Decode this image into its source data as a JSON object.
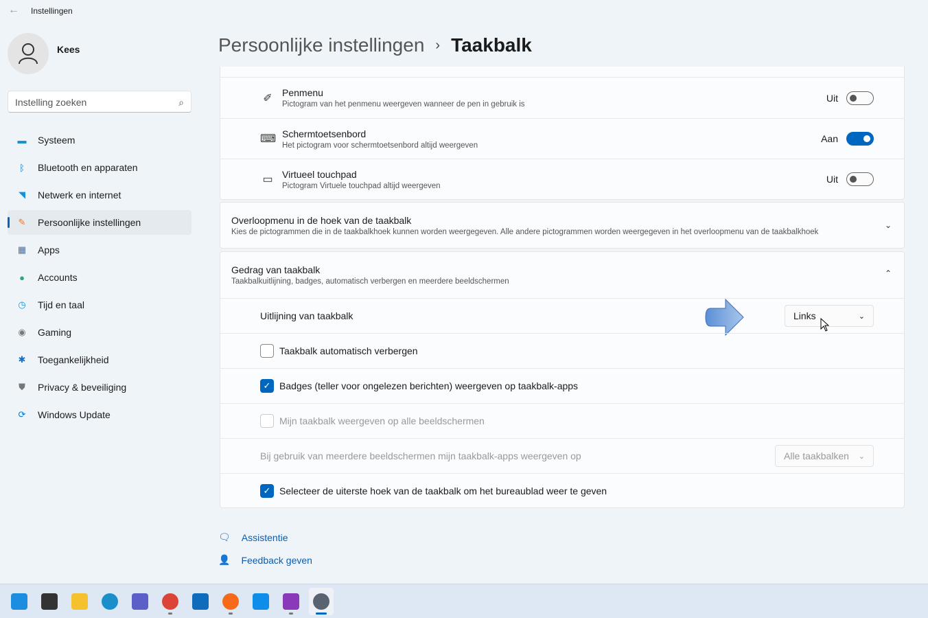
{
  "app": {
    "title": "Instellingen",
    "user": "Kees"
  },
  "search": {
    "placeholder": "Instelling zoeken"
  },
  "nav": [
    {
      "label": "Systeem",
      "icon": "monitor-icon",
      "color": "#1a8fd1"
    },
    {
      "label": "Bluetooth en apparaten",
      "icon": "bluetooth-icon",
      "color": "#0078d4"
    },
    {
      "label": "Netwerk en internet",
      "icon": "wifi-icon",
      "color": "#1a8fd1"
    },
    {
      "label": "Persoonlijke instellingen",
      "icon": "brush-icon",
      "color": "#e07b39",
      "selected": true
    },
    {
      "label": "Apps",
      "icon": "apps-icon",
      "color": "#4a6fa5"
    },
    {
      "label": "Accounts",
      "icon": "person-icon",
      "color": "#2ea67a"
    },
    {
      "label": "Tijd en taal",
      "icon": "clock-globe-icon",
      "color": "#1a8fd1"
    },
    {
      "label": "Gaming",
      "icon": "gamepad-icon",
      "color": "#777"
    },
    {
      "label": "Toegankelijkheid",
      "icon": "accessibility-icon",
      "color": "#1a6fc9"
    },
    {
      "label": "Privacy & beveiliging",
      "icon": "shield-icon",
      "color": "#777"
    },
    {
      "label": "Windows Update",
      "icon": "update-icon",
      "color": "#0078d4"
    }
  ],
  "breadcrumb": {
    "parent": "Persoonlijke instellingen",
    "sep": "›",
    "current": "Taakbalk"
  },
  "pen_rows": [
    {
      "title": "Penmenu",
      "desc": "Pictogram van het penmenu weergeven wanneer de pen in gebruik is",
      "state": "Uit",
      "on": false,
      "icon": "pen-icon"
    },
    {
      "title": "Schermtoetsenbord",
      "desc": "Het pictogram voor schermtoetsenbord altijd weergeven",
      "state": "Aan",
      "on": true,
      "icon": "keyboard-icon"
    },
    {
      "title": "Virtueel touchpad",
      "desc": "Pictogram Virtuele touchpad altijd weergeven",
      "state": "Uit",
      "on": false,
      "icon": "touchpad-icon"
    }
  ],
  "overflow": {
    "title": "Overloopmenu in de hoek van de taakbalk",
    "desc": "Kies de pictogrammen die in de taakbalkhoek kunnen worden weergegeven. Alle andere pictogrammen worden weergegeven in het overloopmenu van de taakbalkhoek",
    "expanded": false
  },
  "behavior": {
    "title": "Gedrag van taakbalk",
    "desc": "Taakbalkuitlijning, badges, automatisch verbergen en meerdere beeldschermen",
    "expanded": true,
    "alignment": {
      "label": "Uitlijning van taakbalk",
      "value": "Links"
    },
    "autohide": {
      "label": "Taakbalk automatisch verbergen",
      "checked": false
    },
    "badges": {
      "label": "Badges (teller voor ongelezen berichten) weergeven op taakbalk-apps",
      "checked": true
    },
    "all_displays": {
      "label": "Mijn taakbalk weergeven op alle beeldschermen",
      "checked": false,
      "disabled": true
    },
    "multi": {
      "label": "Bij gebruik van meerdere beeldschermen mijn taakbalk-apps weergeven op",
      "value": "Alle taakbalken",
      "disabled": true
    },
    "corner": {
      "label": "Selecteer de uiterste hoek van de taakbalk om het bureaublad weer te geven",
      "checked": true
    }
  },
  "links": {
    "help": "Assistentie",
    "feedback": "Feedback geven"
  },
  "taskbar": [
    {
      "name": "start-icon",
      "color": "#1d8de0",
      "running": false
    },
    {
      "name": "task-view-icon",
      "color": "#333",
      "running": false
    },
    {
      "name": "file-explorer-icon",
      "color": "#f5c12e",
      "running": false
    },
    {
      "name": "edge-icon",
      "color": "#1a8fc9",
      "running": false
    },
    {
      "name": "teams-icon",
      "color": "#5b5fc7",
      "running": false
    },
    {
      "name": "chrome-icon",
      "color": "#db4437",
      "running": true
    },
    {
      "name": "outlook-icon",
      "color": "#0f6cbd",
      "running": false
    },
    {
      "name": "firefox-icon",
      "color": "#f66a1a",
      "running": true
    },
    {
      "name": "teamviewer-icon",
      "color": "#0e8ee9",
      "running": false
    },
    {
      "name": "onenote-icon",
      "color": "#8a39b8",
      "running": true
    },
    {
      "name": "settings-icon",
      "color": "#5a6470",
      "running": true,
      "active": true
    }
  ]
}
